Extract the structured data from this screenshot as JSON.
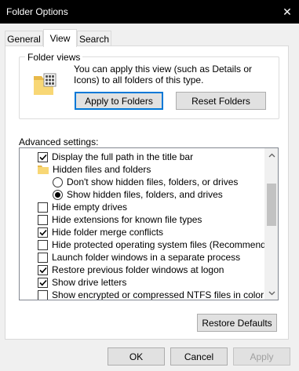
{
  "window": {
    "title": "Folder Options",
    "close_glyph": "✕"
  },
  "tabs": [
    {
      "label": "General",
      "active": false
    },
    {
      "label": "View",
      "active": true
    },
    {
      "label": "Search",
      "active": false
    }
  ],
  "folder_views": {
    "label": "Folder views",
    "description": "You can apply this view (such as Details or Icons) to all folders of this type.",
    "apply_button": "Apply to Folders",
    "reset_button": "Reset Folders"
  },
  "advanced": {
    "label": "Advanced settings:",
    "items": [
      {
        "type": "checkbox",
        "label": "Display the full path in the title bar",
        "checked": true,
        "indent": 1
      },
      {
        "type": "folder",
        "label": "Hidden files and folders",
        "indent": 1
      },
      {
        "type": "radio",
        "label": "Don't show hidden files, folders, or drives",
        "checked": false,
        "indent": 2
      },
      {
        "type": "radio",
        "label": "Show hidden files, folders, and drives",
        "checked": true,
        "indent": 2
      },
      {
        "type": "checkbox",
        "label": "Hide empty drives",
        "checked": false,
        "indent": 1
      },
      {
        "type": "checkbox",
        "label": "Hide extensions for known file types",
        "checked": false,
        "indent": 1
      },
      {
        "type": "checkbox",
        "label": "Hide folder merge conflicts",
        "checked": true,
        "indent": 1
      },
      {
        "type": "checkbox",
        "label": "Hide protected operating system files (Recommended)",
        "checked": false,
        "indent": 1
      },
      {
        "type": "checkbox",
        "label": "Launch folder windows in a separate process",
        "checked": false,
        "indent": 1
      },
      {
        "type": "checkbox",
        "label": "Restore previous folder windows at logon",
        "checked": true,
        "indent": 1
      },
      {
        "type": "checkbox",
        "label": "Show drive letters",
        "checked": true,
        "indent": 1
      },
      {
        "type": "checkbox",
        "label": "Show encrypted or compressed NTFS files in color",
        "checked": false,
        "indent": 1
      }
    ],
    "restore_defaults": "Restore Defaults"
  },
  "dialog_buttons": {
    "ok": "OK",
    "cancel": "Cancel",
    "apply": "Apply"
  },
  "colors": {
    "titlebar": "#000000",
    "focus": "#0078d7",
    "folder": "#f8d775"
  },
  "icons": {
    "close": "close-icon",
    "folder": "folder-icon",
    "scroll_up": "chevron-up-icon",
    "scroll_down": "chevron-down-icon"
  }
}
